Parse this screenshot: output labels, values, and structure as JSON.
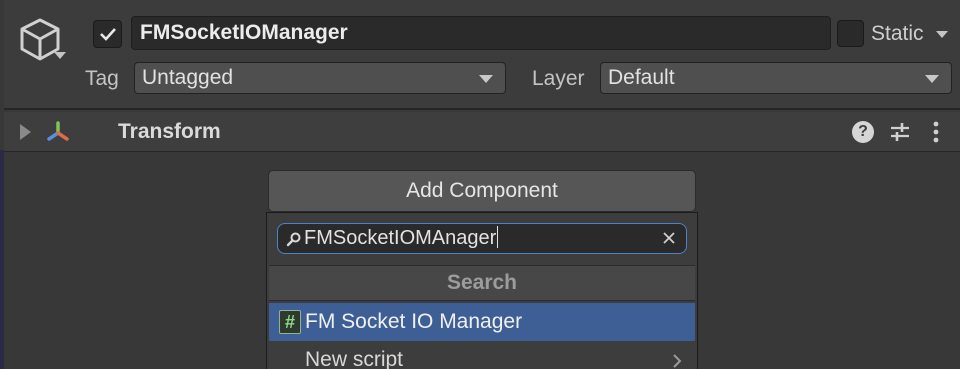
{
  "header": {
    "object_name": "FMSocketIOManager",
    "static_label": "Static",
    "tag_label": "Tag",
    "tag_value": "Untagged",
    "layer_label": "Layer",
    "layer_value": "Default"
  },
  "component": {
    "title": "Transform",
    "help_glyph": "?"
  },
  "add_component": {
    "button_label": "Add Component",
    "search_value": "FMSocketIOMAnager",
    "section_header": "Search",
    "results": [
      {
        "icon_glyph": "#",
        "label": "FM Socket IO Manager",
        "selected": true
      },
      {
        "label": "New script",
        "has_submenu": true
      }
    ]
  },
  "colors": {
    "background": "#383838",
    "selection": "#3e5f96",
    "focus_border": "#4a84c8"
  },
  "icons": [
    "gameobject-cube-icon",
    "transform-icon",
    "help-icon",
    "preset-settings-icon",
    "more-options-icon",
    "search-icon",
    "clear-icon",
    "script-hash-icon",
    "chevron-right-icon"
  ]
}
